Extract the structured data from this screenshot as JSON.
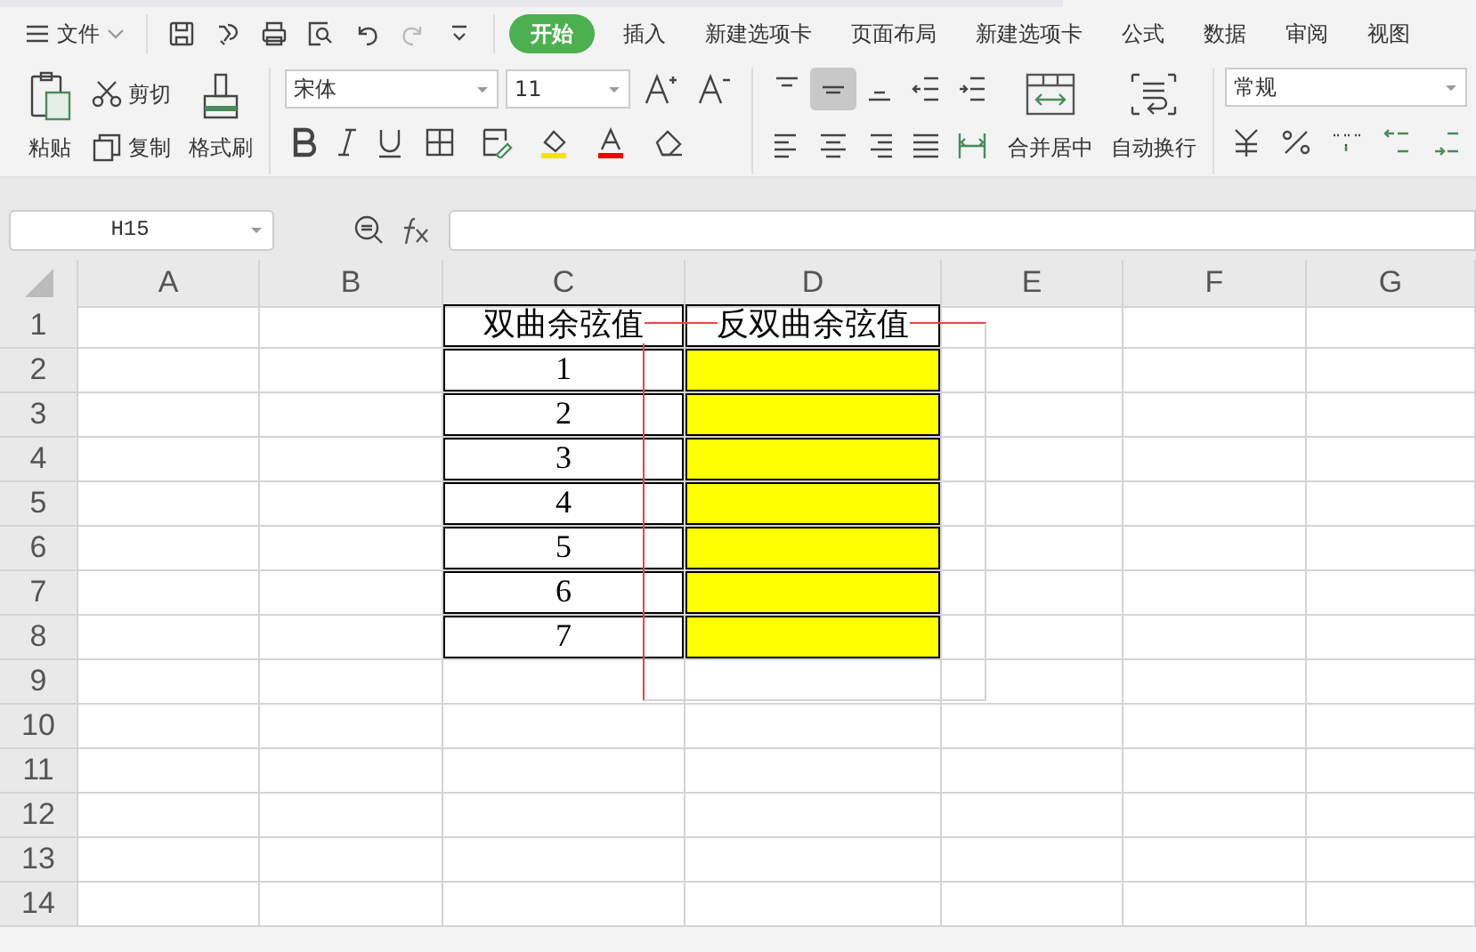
{
  "menu": {
    "label": "文件"
  },
  "quick_access": [
    {
      "kind": "save",
      "disabled": false
    },
    {
      "kind": "export",
      "disabled": false
    },
    {
      "kind": "print",
      "disabled": false
    },
    {
      "kind": "preview",
      "disabled": false
    },
    {
      "kind": "undo",
      "disabled": false
    },
    {
      "kind": "redo",
      "disabled": true
    },
    {
      "kind": "more",
      "disabled": false
    }
  ],
  "tabs": [
    {
      "label": "开始",
      "selected": true
    },
    {
      "label": "插入",
      "selected": false
    },
    {
      "label": "新建选项卡",
      "selected": false
    },
    {
      "label": "页面布局",
      "selected": false
    },
    {
      "label": "新建选项卡",
      "selected": false
    },
    {
      "label": "公式",
      "selected": false
    },
    {
      "label": "数据",
      "selected": false
    },
    {
      "label": "审阅",
      "selected": false
    },
    {
      "label": "视图",
      "selected": false
    }
  ],
  "clipboard": {
    "paste": "粘贴",
    "cut": "剪切",
    "copy": "复制",
    "format_painter": "格式刷"
  },
  "font": {
    "name": "宋体",
    "size": "11"
  },
  "alignment": [
    {
      "kind": "top",
      "selected": false
    },
    {
      "kind": "middle",
      "selected": true
    },
    {
      "kind": "bottom",
      "selected": false
    },
    {
      "kind": "outdent",
      "selected": false
    },
    {
      "kind": "indent",
      "selected": false
    }
  ],
  "merge": {
    "label": "合并居中"
  },
  "wrap": {
    "label": "自动换行"
  },
  "number_format": {
    "value": "常规"
  },
  "name_box": {
    "value": "H15"
  },
  "sheet": {
    "columns": [
      "A",
      "B",
      "C",
      "D",
      "E",
      "F",
      "G"
    ],
    "rows": [
      {
        "label": "1",
        "cells": [
          null,
          null,
          {
            "text": "双曲余弦值",
            "bordered": true
          },
          {
            "text": "反双曲余弦值",
            "bordered": true
          },
          null,
          null,
          null
        ]
      },
      {
        "label": "2",
        "cells": [
          null,
          null,
          {
            "text": "1",
            "bordered": true
          },
          {
            "bordered": true,
            "color": "#ffff00"
          },
          null,
          null,
          null
        ]
      },
      {
        "label": "3",
        "cells": [
          null,
          null,
          {
            "text": "2",
            "bordered": true
          },
          {
            "bordered": true,
            "color": "#ffff00"
          },
          null,
          null,
          null
        ]
      },
      {
        "label": "4",
        "cells": [
          null,
          null,
          {
            "text": "3",
            "bordered": true
          },
          {
            "bordered": true,
            "color": "#ffff00"
          },
          null,
          null,
          null
        ]
      },
      {
        "label": "5",
        "cells": [
          null,
          null,
          {
            "text": "4",
            "bordered": true
          },
          {
            "bordered": true,
            "color": "#ffff00"
          },
          null,
          null,
          null
        ]
      },
      {
        "label": "6",
        "cells": [
          null,
          null,
          {
            "text": "5",
            "bordered": true
          },
          {
            "bordered": true,
            "color": "#ffff00"
          },
          null,
          null,
          null
        ]
      },
      {
        "label": "7",
        "cells": [
          null,
          null,
          {
            "text": "6",
            "bordered": true
          },
          {
            "bordered": true,
            "color": "#ffff00"
          },
          null,
          null,
          null
        ]
      },
      {
        "label": "8",
        "cells": [
          null,
          null,
          {
            "text": "7",
            "bordered": true
          },
          {
            "bordered": true,
            "color": "#ffff00"
          },
          null,
          null,
          null
        ]
      },
      {
        "label": "9",
        "cells": [
          null,
          null,
          null,
          null,
          null,
          null,
          null
        ]
      },
      {
        "label": "10",
        "cells": [
          null,
          null,
          null,
          null,
          null,
          null,
          null
        ]
      },
      {
        "label": "11",
        "cells": [
          null,
          null,
          null,
          null,
          null,
          null,
          null
        ]
      },
      {
        "label": "12",
        "cells": [
          null,
          null,
          null,
          null,
          null,
          null,
          null
        ]
      },
      {
        "label": "13",
        "cells": [
          null,
          null,
          null,
          null,
          null,
          null,
          null
        ]
      },
      {
        "label": "14",
        "cells": [
          null,
          null,
          null,
          null,
          null,
          null,
          null
        ]
      }
    ]
  }
}
